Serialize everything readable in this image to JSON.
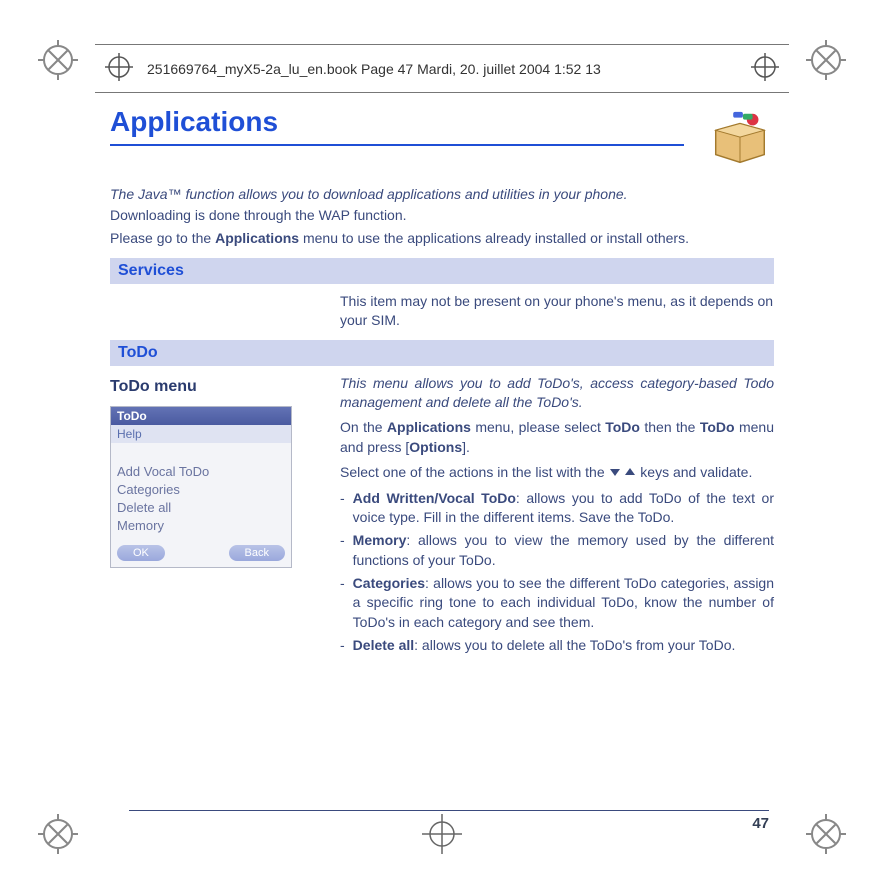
{
  "meta": {
    "header_line": "251669764_myX5-2a_lu_en.book  Page 47  Mardi, 20. juillet 2004  1:52 13"
  },
  "title": "Applications",
  "intro": {
    "italic": "The Java™ function allows you to download applications and utilities in your phone.",
    "line2": "Downloading is done through the WAP function.",
    "line3_a": "Please go to the ",
    "line3_bold": "Applications",
    "line3_b": " menu to use the applications already installed or install others."
  },
  "sections": {
    "services": {
      "title": "Services",
      "body": "This item may not be present on your phone's menu, as it depends on your SIM."
    },
    "todo": {
      "title": "ToDo",
      "subhead": "ToDo menu",
      "desc_italic": "This menu allows you to add ToDo's, access category-based Todo management and delete all the ToDo's.",
      "p1_a": "On the ",
      "p1_b1": "Applications",
      "p1_c": " menu, please select ",
      "p1_b2": "ToDo",
      "p1_d": " then the ",
      "p1_b3": "ToDo",
      "p1_e": " menu and press [",
      "p1_b4": "Options",
      "p1_f": "].",
      "p2_a": "Select one of the actions in the list with the ",
      "p2_b": " keys and validate.",
      "options": [
        {
          "label": "Add Written/Vocal ToDo",
          "text": ": allows you to add ToDo of the text or voice type. Fill in the different items. Save the ToDo."
        },
        {
          "label": "Memory",
          "text": ": allows you to view the memory used by the different functions of your ToDo."
        },
        {
          "label": "Categories",
          "text": ": allows you to see the different ToDo categories, assign a specific ring tone to each individual ToDo, know the number of ToDo's in each category and see them."
        },
        {
          "label": "Delete all",
          "text": ": allows you to delete all the ToDo's from your ToDo."
        }
      ]
    }
  },
  "phone_mock": {
    "title": "ToDo",
    "help": "Help",
    "items": [
      "Add Vocal ToDo",
      "Categories",
      "Delete all",
      "Memory"
    ],
    "ok": "OK",
    "back": "Back"
  },
  "page_number": "47"
}
